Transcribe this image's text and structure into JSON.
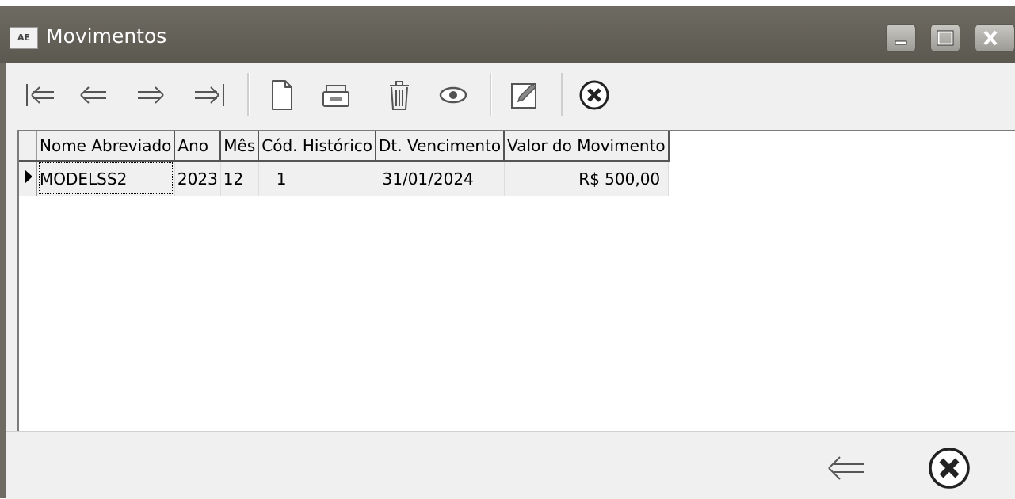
{
  "window": {
    "app_badge": "AE",
    "title": "Movimentos"
  },
  "toolbar": {
    "icons": [
      "first-record-icon",
      "prev-record-icon",
      "next-record-icon",
      "last-record-icon",
      "new-record-icon",
      "print-icon",
      "delete-icon",
      "view-icon",
      "edit-icon",
      "close-icon"
    ]
  },
  "grid": {
    "columns": [
      "Nome Abreviado",
      "Ano",
      "Mês",
      "Cód. Histórico",
      "Dt. Vencimento",
      "Valor do Movimento"
    ],
    "rows": [
      {
        "nome": "MODELSS2",
        "ano": "2023",
        "mes": "12",
        "cod": "1",
        "vencimento": "31/01/2024",
        "valor": "R$ 500,00"
      }
    ]
  },
  "footer": {
    "icons": [
      "back-icon",
      "close-icon"
    ]
  }
}
